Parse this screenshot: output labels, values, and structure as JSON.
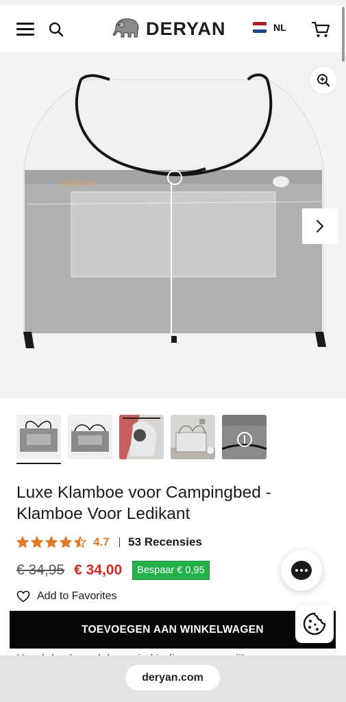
{
  "header": {
    "logo_text": "DERYAN",
    "language_code": "NL",
    "icons": [
      "menu-icon",
      "search-icon",
      "elephant-logo-icon",
      "nl-flag-icon",
      "cart-icon"
    ]
  },
  "gallery": {
    "icons": [
      "zoom-in-icon",
      "chevron-right-icon"
    ],
    "thumbnail_count": 5,
    "active_thumbnail": 1
  },
  "product": {
    "title_line1": "Luxe Klamboe voor Campingbed -",
    "title_line2": "Klamboe Voor Ledikant",
    "rating_value": "4.7",
    "rating_stars": 4.5,
    "reviews_label": "53 Recensies",
    "old_price": "€ 34,95",
    "new_price": "€ 34,00",
    "save_badge": "Bespaar  € 0,95",
    "favorites_label": "Add to Favorites",
    "description_peek": "Houd de slaapplek van je kindje muggenvrij!"
  },
  "actions": {
    "add_to_cart_label": "TOEVOEGEN AAN WINKELWAGEN"
  },
  "browser": {
    "url": "deryan.com"
  },
  "colors": {
    "star": "#e07a2a",
    "sale_price": "#d42727",
    "save_badge": "#23b24a",
    "cart_button": "#060606"
  }
}
